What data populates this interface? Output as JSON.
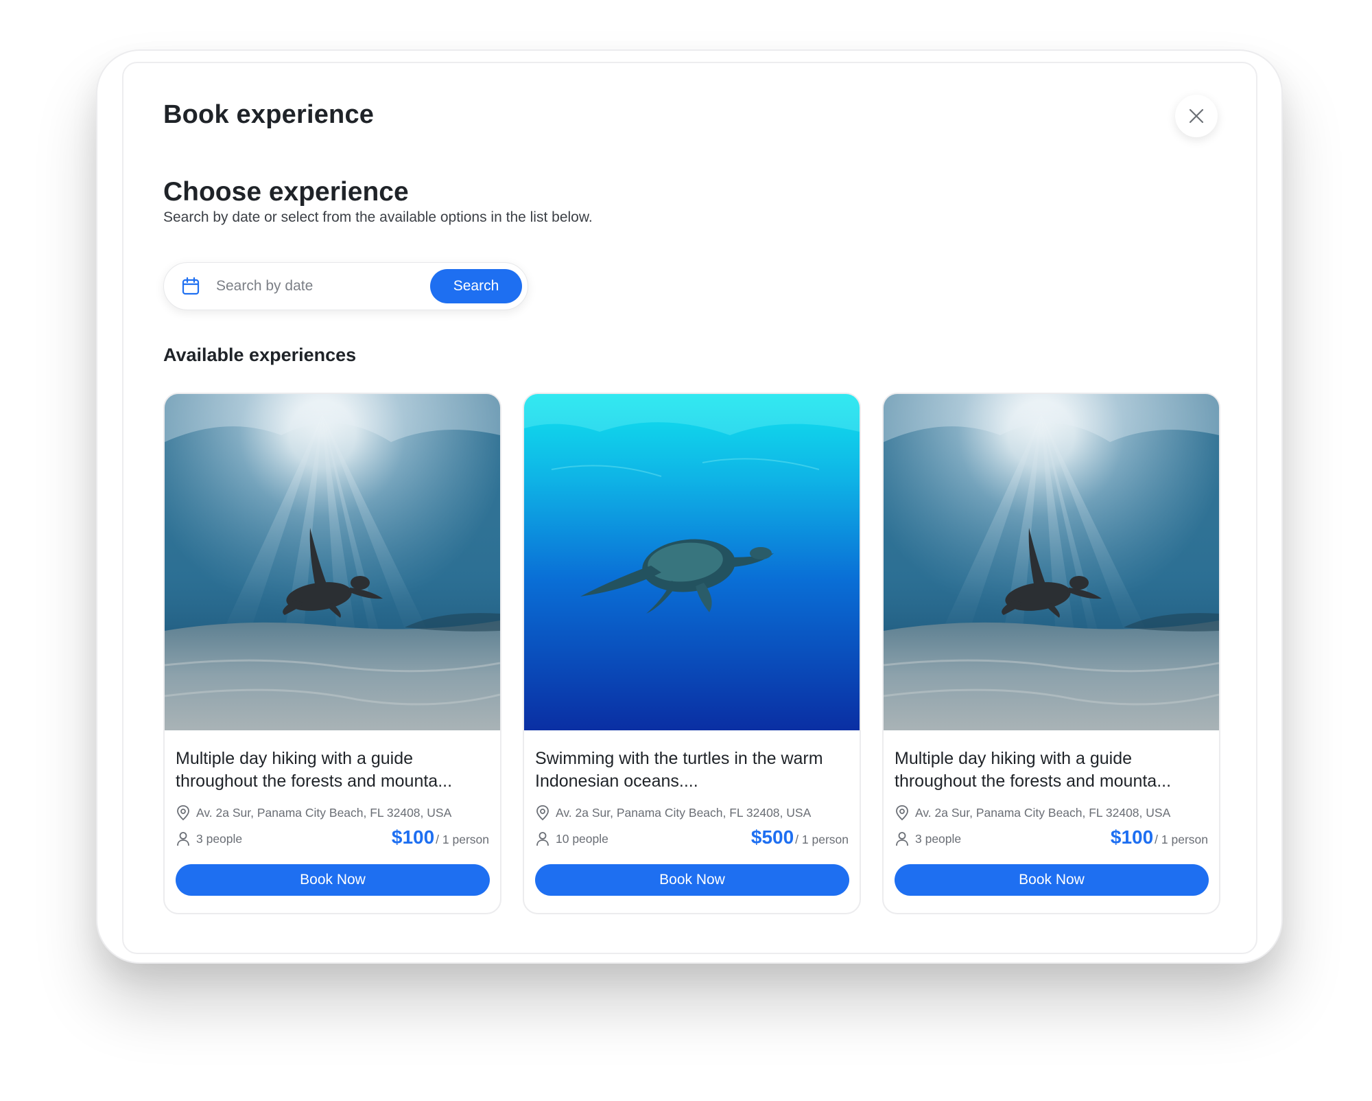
{
  "modal": {
    "title": "Book experience",
    "close_icon": "close-icon"
  },
  "section": {
    "title": "Choose experience",
    "subtitle": "Search by date or select from the available options in the list below."
  },
  "search": {
    "icon": "calendar-icon",
    "placeholder": "Search by date",
    "value": "",
    "button_label": "Search"
  },
  "list": {
    "title": "Available experiences"
  },
  "cards": [
    {
      "image": "sea-turtle-sunlit-seabed-photo",
      "title": "Multiple day hiking with a guide throughout the forests and mounta...",
      "address": "Av. 2a Sur, Panama City Beach, FL 32408, USA",
      "people": "3 people",
      "price": "$100",
      "price_unit": "/ 1 person",
      "button_label": "Book Now"
    },
    {
      "image": "sea-turtle-deep-blue-photo",
      "title": "Swimming with the turtles in the warm Indonesian oceans....",
      "address": "Av. 2a Sur, Panama City Beach, FL 32408, USA",
      "people": "10 people",
      "price": "$500",
      "price_unit": "/ 1 person",
      "button_label": "Book Now"
    },
    {
      "image": "sea-turtle-sunlit-seabed-photo",
      "title": "Multiple day hiking with a guide throughout the forests and mounta...",
      "address": "Av. 2a Sur, Panama City Beach, FL 32408, USA",
      "people": "3 people",
      "price": "$100",
      "price_unit": "/ 1 person",
      "button_label": "Book Now"
    }
  ],
  "colors": {
    "accent": "#1e6ff1",
    "text_primary": "#1f2328",
    "text_secondary": "#6a6e75"
  }
}
